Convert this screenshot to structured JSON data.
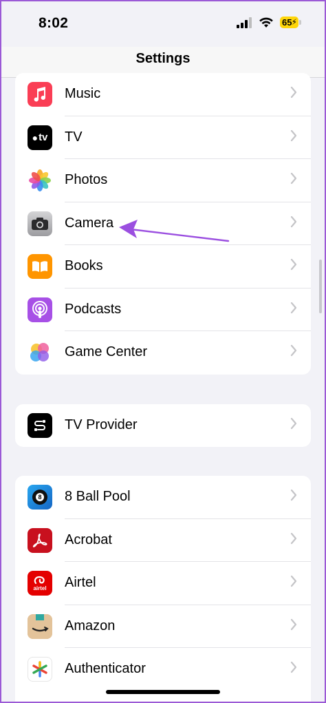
{
  "status": {
    "time": "8:02",
    "battery": "65"
  },
  "nav": {
    "title": "Settings"
  },
  "group1": [
    {
      "label": "Music",
      "icon": "music-icon"
    },
    {
      "label": "TV",
      "icon": "apple-tv-icon",
      "icon_text": "tv"
    },
    {
      "label": "Photos",
      "icon": "photos-icon"
    },
    {
      "label": "Camera",
      "icon": "camera-icon"
    },
    {
      "label": "Books",
      "icon": "books-icon"
    },
    {
      "label": "Podcasts",
      "icon": "podcasts-icon"
    },
    {
      "label": "Game Center",
      "icon": "game-center-icon"
    }
  ],
  "group2": [
    {
      "label": "TV Provider",
      "icon": "tv-provider-icon"
    }
  ],
  "group3": [
    {
      "label": "8 Ball Pool",
      "icon": "8-ball-pool-icon",
      "icon_text": "8"
    },
    {
      "label": "Acrobat",
      "icon": "acrobat-icon"
    },
    {
      "label": "Airtel",
      "icon": "airtel-icon",
      "icon_text": "airtel"
    },
    {
      "label": "Amazon",
      "icon": "amazon-icon"
    },
    {
      "label": "Authenticator",
      "icon": "authenticator-icon"
    }
  ],
  "colors": {
    "accent_arrow": "#9b4fe0",
    "music": "#fa3e55",
    "books": "#ff9500",
    "podcasts": "#a750e6",
    "acrobat": "#c8101e",
    "airtel": "#e40000"
  }
}
